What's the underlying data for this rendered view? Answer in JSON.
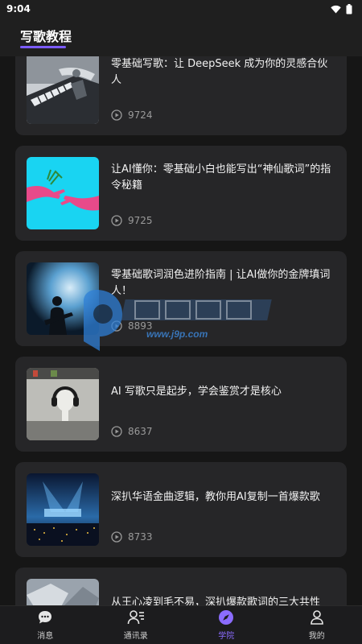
{
  "status_bar": {
    "time": "9:04"
  },
  "header": {
    "title": "写歌教程"
  },
  "tutorials": [
    {
      "title": "零基础写歌：让 DeepSeek 成为你的灵感合伙人",
      "views": "9724",
      "thumb_icon": "robot-piano-image"
    },
    {
      "title": "让AI懂你：零基础小白也能写出“神仙歌词”的指令秘籍",
      "views": "9725",
      "thumb_icon": "hands-reaching-image"
    },
    {
      "title": "零基础歌词润色进阶指南 | 让AI做你的金牌填词人！",
      "views": "8893",
      "thumb_icon": "guitarist-stage-image"
    },
    {
      "title": "AI 写歌只是起步，学会鉴赏才是核心",
      "views": "8637",
      "thumb_icon": "headphones-bust-image"
    },
    {
      "title": "深扒华语金曲逻辑，教你用AI复制一首爆款歌",
      "views": "8733",
      "thumb_icon": "concert-stage-image"
    },
    {
      "title": "从王心凌到毛不易，深扒爆款歌词的三大共性",
      "views": "",
      "thumb_icon": "crystal-texture-image"
    }
  ],
  "watermark": {
    "url": "www.j9p.com"
  },
  "bottom_nav": [
    {
      "label": "消息",
      "icon": "chat-bubble-icon"
    },
    {
      "label": "通讯录",
      "icon": "contacts-icon"
    },
    {
      "label": "学院",
      "icon": "compass-icon"
    },
    {
      "label": "我的",
      "icon": "person-icon"
    }
  ],
  "colors": {
    "accent": "#7c5cff",
    "card_bg": "#262628",
    "page_bg": "#161616"
  }
}
